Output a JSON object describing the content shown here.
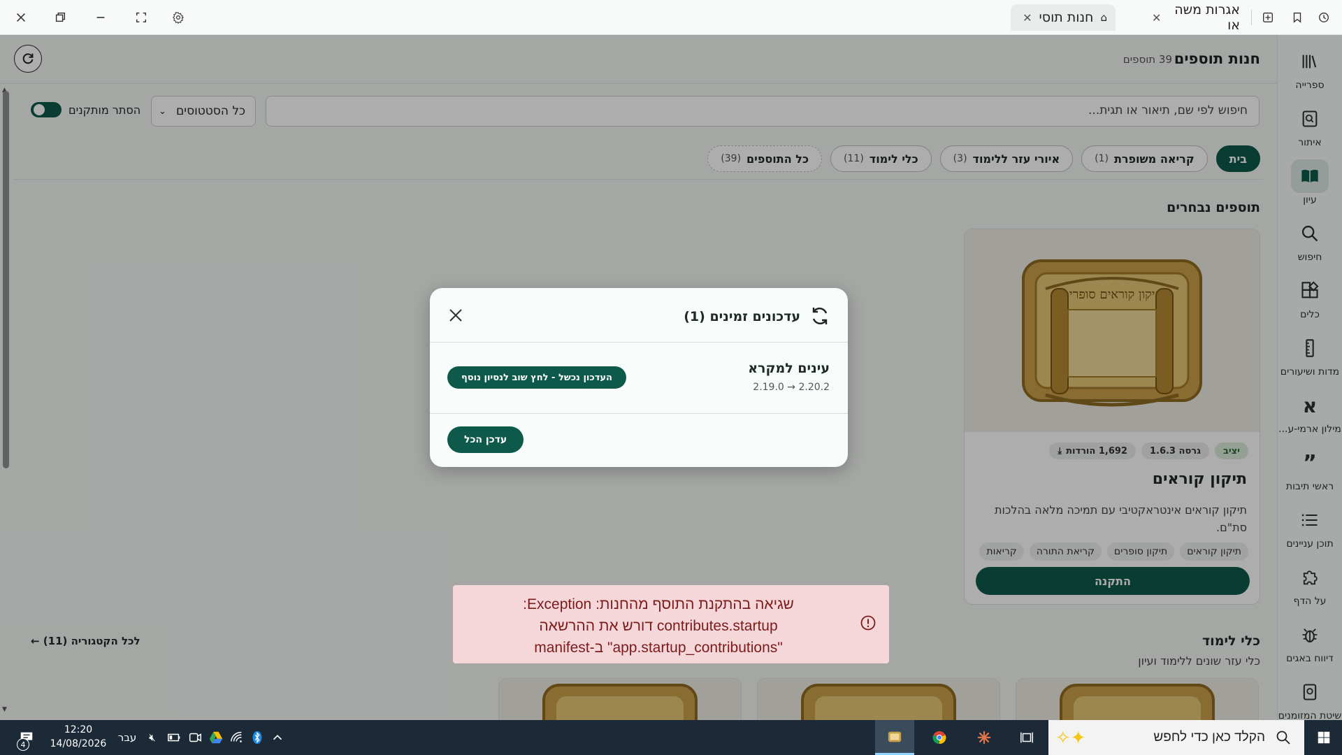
{
  "titlebar": {
    "tabs": [
      {
        "label": "חנות תוסי",
        "active": true
      },
      {
        "label": "אגרות משה או",
        "active": false
      }
    ]
  },
  "rail": {
    "items": [
      {
        "label": "ספרייה",
        "icon": "library-icon"
      },
      {
        "label": "איתור",
        "icon": "locate-icon"
      },
      {
        "label": "עיון",
        "icon": "book-open-icon",
        "active": true
      },
      {
        "label": "חיפוש",
        "icon": "search-icon"
      },
      {
        "label": "כלים",
        "icon": "tools-icon"
      },
      {
        "label": "מדות ושיעורים",
        "icon": "ruler-icon"
      },
      {
        "label": "מילון ארמי-ע...",
        "icon": "aleph-icon"
      },
      {
        "label": "ראשי תיבות",
        "icon": "quote-icon"
      },
      {
        "label": "תוכן עניינים",
        "icon": "list-icon"
      },
      {
        "label": "על הדף",
        "icon": "puzzle-icon"
      },
      {
        "label": "דיווח באגים",
        "icon": "bug-icon"
      },
      {
        "label": "שיטת המזומנים",
        "icon": "calculator-icon"
      }
    ]
  },
  "header": {
    "title": "חנות תוספים",
    "count": "39 תוספים"
  },
  "filters": {
    "search_placeholder": "חיפוש לפי שם, תיאור או תגית...",
    "status_select": "כל הסטטוסים",
    "hide_installed": "הסתר מותקנים",
    "hide_installed_on": true
  },
  "chips": [
    {
      "label": "בית",
      "count": "",
      "active": true
    },
    {
      "label": "קריאה משופרת",
      "count": "(1)"
    },
    {
      "label": "איורי עזר ללימוד",
      "count": "(3)"
    },
    {
      "label": "כלי לימוד",
      "count": "(11)"
    },
    {
      "label": "כל התוספים",
      "count": "(39)",
      "dashed": true
    }
  ],
  "featured": {
    "section_title": "תוספים נבחרים",
    "card": {
      "image_caption": "תיקון קוראים סופרים",
      "status": "יציב",
      "version": "גרסה 1.6.3",
      "downloads": "1,692 הורדות",
      "title": "תיקון קוראים",
      "description": "תיקון קוראים אינטראקטיבי עם תמיכה מלאה בהלכות סת\"ם.",
      "tags": [
        "תיקון קוראים",
        "תיקון סופרים",
        "קריאת התורה",
        "קריאות"
      ],
      "install_label": "התקנה"
    }
  },
  "study_tools": {
    "title": "כלי לימוד",
    "subtitle": "כלי עזר שונים ללימוד ועיון",
    "category_link": "לכל הקטגוריה (11) ←"
  },
  "modal": {
    "title": "עדכונים זמינים (1)",
    "update": {
      "name": "עינים למקרא",
      "version": "2.19.0 → 2.20.2",
      "retry_label": "העדכון נכשל - לחץ שוב לנסיון נוסף"
    },
    "update_all_label": "עדכן הכל"
  },
  "toast": {
    "line1": "שגיאה בהתקנת התוסף מהחנות: Exception:",
    "line2": "contributes.startup דורש את ההרשאה",
    "line3": "\"app.startup_contributions\" ב-manifest"
  },
  "taskbar": {
    "search_placeholder": "הקלד כאן כדי לחפש",
    "time": "12:20",
    "date": "14/08/2026",
    "language": "עבר",
    "notification_count": "4"
  },
  "colors": {
    "accent": "#0e5a4a",
    "error_bg": "#f6d7d9",
    "error_text": "#7b1b1b"
  }
}
